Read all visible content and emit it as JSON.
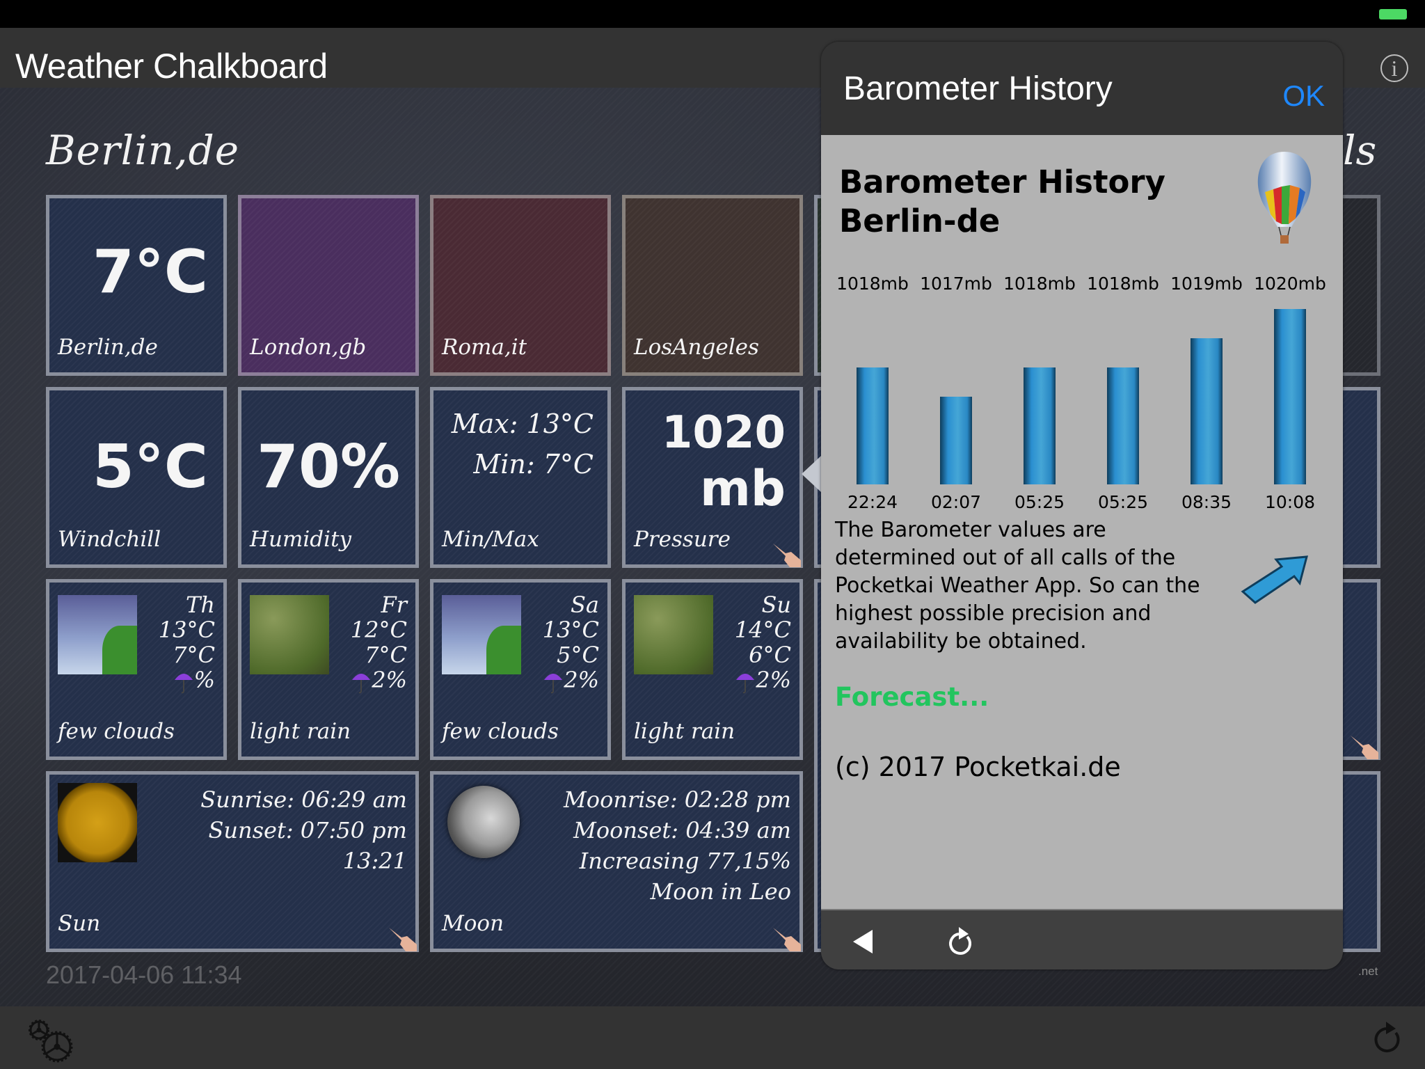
{
  "app": {
    "title": "Weather Chalkboard",
    "info_icon": "info-icon",
    "battery_icon": "battery-icon"
  },
  "board": {
    "city_header": "Berlin,de",
    "city_header_right_partial": "ls",
    "timestamp": "2017-04-06 11:34",
    "footer_partial": ".net"
  },
  "cities": [
    {
      "label": "Berlin,de",
      "temp": "7°C"
    },
    {
      "label": "London,gb",
      "temp": ""
    },
    {
      "label": "Roma,it",
      "temp": ""
    },
    {
      "label": "LosAngeles",
      "temp": ""
    }
  ],
  "conditions": {
    "windchill": {
      "value": "5°C",
      "label": "Windchill"
    },
    "humidity": {
      "value": "70%",
      "label": "Humidity"
    },
    "minmax": {
      "max": "Max: 13°C",
      "min": "Min: 7°C",
      "label": "Min/Max"
    },
    "pressure": {
      "value": "1020",
      "unit": "mb",
      "label": "Pressure"
    }
  },
  "forecast": [
    {
      "day": "Th",
      "high": "13°C",
      "low": "7°C",
      "rain": "%",
      "desc": "few clouds",
      "icon": "few-clouds-icon"
    },
    {
      "day": "Fr",
      "high": "12°C",
      "low": "7°C",
      "rain": "2%",
      "desc": "light rain",
      "icon": "light-rain-icon"
    },
    {
      "day": "Sa",
      "high": "13°C",
      "low": "5°C",
      "rain": "2%",
      "desc": "few clouds",
      "icon": "few-clouds-icon"
    },
    {
      "day": "Su",
      "high": "14°C",
      "low": "6°C",
      "rain": "2%",
      "desc": "light rain",
      "icon": "light-rain-icon"
    }
  ],
  "sun": {
    "label": "Sun",
    "sunrise": "Sunrise: 06:29 am",
    "sunset": "Sunset: 07:50 pm",
    "daylength": "13:21"
  },
  "moon": {
    "label": "Moon",
    "moonrise": "Moonrise: 02:28 pm",
    "moonset": "Moonset: 04:39 am",
    "phase": "Increasing   77,15%",
    "sign": "Moon in Leo"
  },
  "popover": {
    "title": "Barometer History",
    "ok_label": "OK",
    "heading_line1": "Barometer History",
    "heading_line2": "Berlin-de",
    "description": "The Barometer values are determined out of all calls of the Pocketkai Weather App. So can the highest possible precision and availability be obtained.",
    "forecast_link": "Forecast...",
    "copyright": "(c) 2017 Pocketkai.de",
    "accent_color": "#1e88ff",
    "forecast_color": "#22c55e"
  },
  "chart_data": {
    "type": "bar",
    "title": "Barometer History Berlin-de",
    "categories": [
      "22:24",
      "02:07",
      "05:25",
      "05:25",
      "08:35",
      "10:08"
    ],
    "values": [
      1018,
      1017,
      1018,
      1018,
      1019,
      1020
    ],
    "value_labels": [
      "1018mb",
      "1017mb",
      "1018mb",
      "1018mb",
      "1019mb",
      "1020mb"
    ],
    "unit": "mb",
    "xlabel": "",
    "ylabel": "",
    "ylim": [
      1014,
      1020
    ],
    "grid": false,
    "bar_color": "#2f9bd6"
  }
}
